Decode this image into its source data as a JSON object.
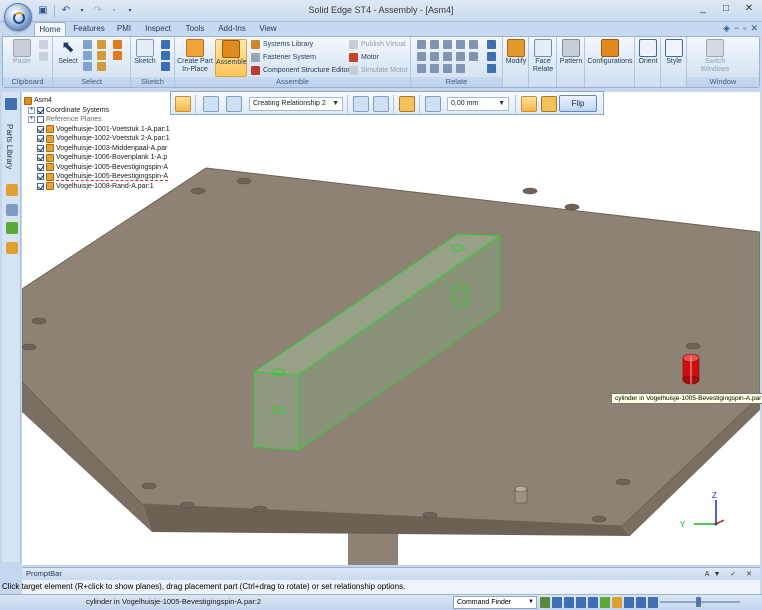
{
  "window": {
    "title": "Solid Edge ST4 - Assembly - [Asm4]",
    "controls": [
      "_",
      "□",
      "✕"
    ]
  },
  "tabs": [
    {
      "label": "Home"
    },
    {
      "label": "Features"
    },
    {
      "label": "PMI"
    },
    {
      "label": "Inspect"
    },
    {
      "label": "Tools"
    },
    {
      "label": "Add-Ins"
    },
    {
      "label": "View"
    }
  ],
  "ribbon": {
    "clipboard": {
      "group": "Clipboard",
      "paste": "Paste"
    },
    "select": {
      "group": "Select",
      "select": "Select"
    },
    "sketch": {
      "group": "Sketch",
      "sketch": "Sketch"
    },
    "assemble": {
      "group": "Assemble",
      "create_part": "Create Part In-Place",
      "assemble": "Assemble",
      "systems_library": "Systems Library",
      "fastener_system": "Fastener System",
      "component_structure_editor": "Component Structure Editor",
      "publish_virtual": "Publish Virtual",
      "motor": "Motor",
      "simulate_motor": "Simulate Motor"
    },
    "relate": {
      "group": "Relate"
    },
    "modify": "Modify",
    "face_relate": "Face Relate",
    "pattern": "Pattern",
    "configurations": "Configurations",
    "orient": "Orient",
    "style": "Style",
    "window": {
      "group": "Window",
      "switch_windows": "Switch Windows"
    }
  },
  "side_tab": "Parts Library",
  "tree": {
    "root": "Asm4",
    "items": [
      {
        "label": "Coordinate Systems",
        "type": "folder",
        "checked": true,
        "expand": "+"
      },
      {
        "label": "Reference Planes",
        "type": "folder",
        "checked": false,
        "expand": "+"
      },
      {
        "label": "Vogelhuisje-1001-Voetstuk 1-A.par:1",
        "type": "part",
        "checked": true
      },
      {
        "label": "Vogelhuisje-1002-Voetstuk 2-A.par:1",
        "type": "part",
        "checked": true
      },
      {
        "label": "Vogelhuisje-1003-Middenpaal-A.par",
        "type": "part",
        "checked": true
      },
      {
        "label": "Vogelhuisje-1006-Bovenplank 1-A.p",
        "type": "part",
        "checked": true
      },
      {
        "label": "Vogelhuisje-1005-Bevestigingspin-A",
        "type": "part",
        "checked": true
      },
      {
        "label": "Vogelhuisje-1005-Bevestigingspin-A",
        "type": "part",
        "checked": true,
        "flag": "underline"
      },
      {
        "label": "Vogelhuisje-1008-Rand-A.par:1",
        "type": "part",
        "checked": true
      }
    ]
  },
  "command_bar": {
    "relationship": "Creating Relationship 2",
    "offset": "0,00 mm",
    "flip": "Flip"
  },
  "tooltip": "cylinder in Vogelhuisje-1005-Bevestigingspin-A.par:2",
  "triad": {
    "x": "X",
    "y": "Y",
    "z": "Z"
  },
  "prompt_bar": {
    "title": "PromptBar",
    "controls": "A▼ ✓ ✕",
    "text": "Click target element (R+click to show planes), drag placement part (Ctrl+drag to rotate) or set relationship options."
  },
  "status_bar": {
    "text": "cylinder in Vogelhuisje-1005-Bevestigingspin-A.par:2",
    "command_finder": "Command Finder"
  },
  "colors": {
    "plate_top": "#8e8274",
    "plate_side": "#6e6357",
    "highlight_green": "#33cc33",
    "pin_red": "#cc1010",
    "ribbon_bg": "#dce8f6"
  }
}
